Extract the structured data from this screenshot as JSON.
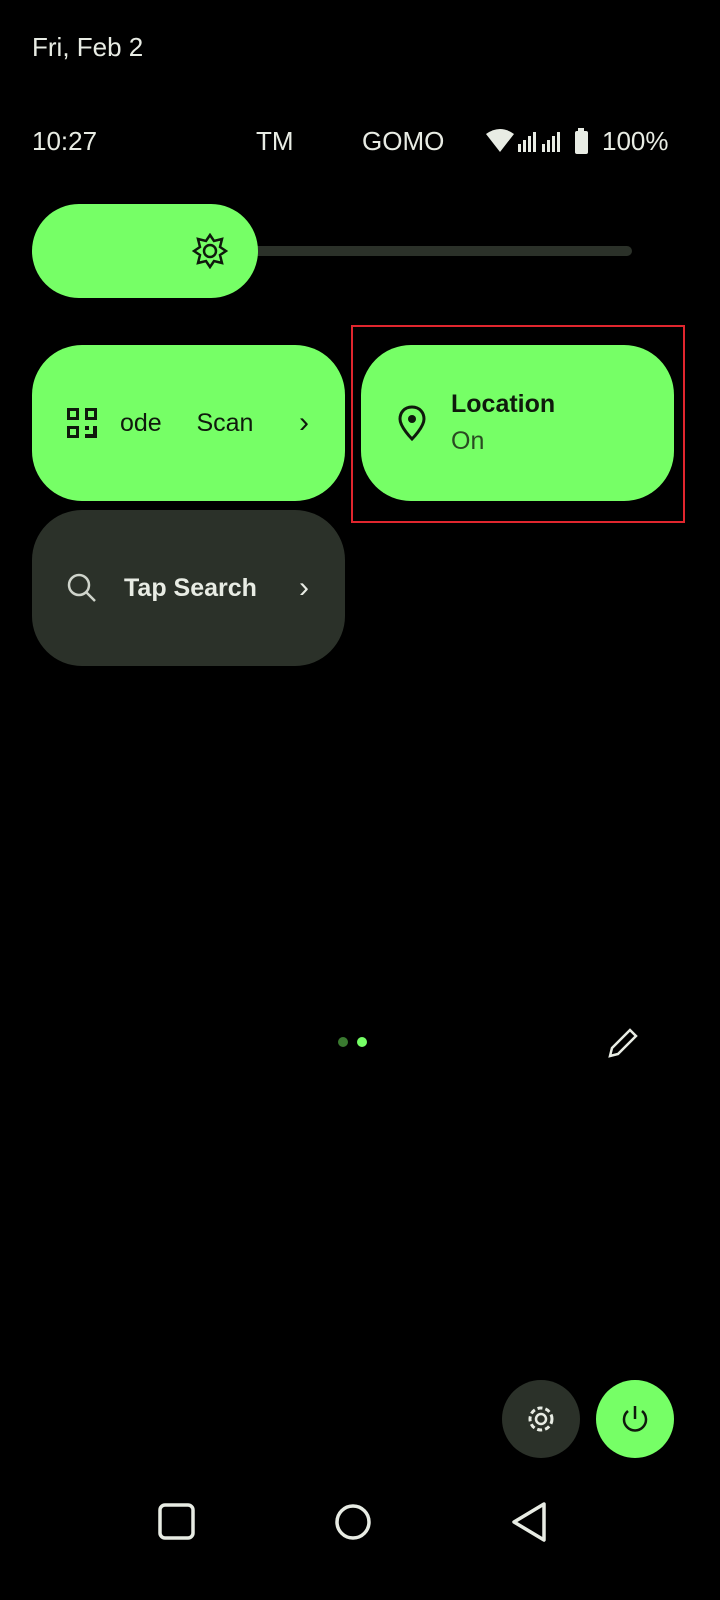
{
  "status_bar": {
    "date": "Fri, Feb 2",
    "time": "10:27",
    "carrier1": "TM",
    "carrier2": "GOMO",
    "battery": "100%",
    "icons": [
      "wifi-icon",
      "signal-icon",
      "signal-icon",
      "battery-icon"
    ]
  },
  "brightness": {
    "level": 0.38,
    "icon": "brightness-icon"
  },
  "tiles": [
    {
      "label": "Code Scanner",
      "visible_text": "ode     Scan",
      "icon": "qr-code-icon",
      "state": "on"
    },
    {
      "label": "Location",
      "sublabel": "On",
      "icon": "location-pin-icon",
      "state": "on"
    },
    {
      "label": "Tap Search",
      "icon": "search-icon",
      "state": "off"
    }
  ],
  "pager": {
    "pages": 2,
    "current": 2
  },
  "colors": {
    "accent": "#76ff66",
    "tile_dark": "#2b3129",
    "highlight": "#e0262e"
  }
}
